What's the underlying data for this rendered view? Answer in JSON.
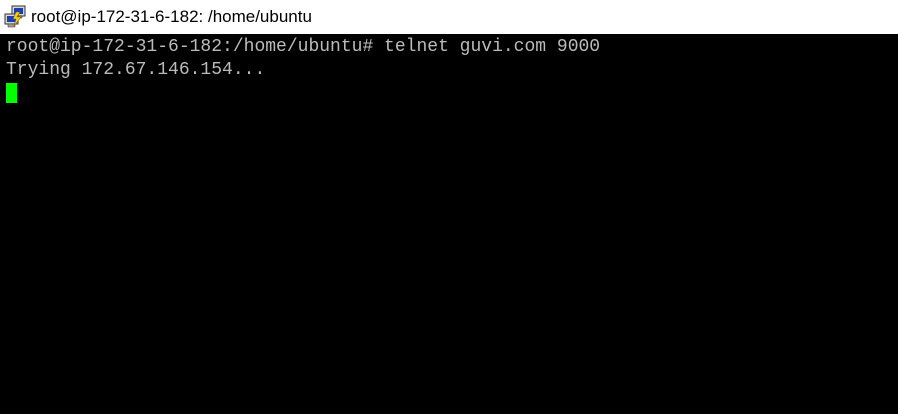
{
  "window": {
    "title": "root@ip-172-31-6-182: /home/ubuntu",
    "icon": "putty-icon"
  },
  "terminal": {
    "lines": [
      "root@ip-172-31-6-182:/home/ubuntu# telnet guvi.com 9000",
      "Trying 172.67.146.154..."
    ],
    "text_color": "#bbbbbb",
    "background_color": "#000000",
    "cursor_color": "#00ff00"
  }
}
